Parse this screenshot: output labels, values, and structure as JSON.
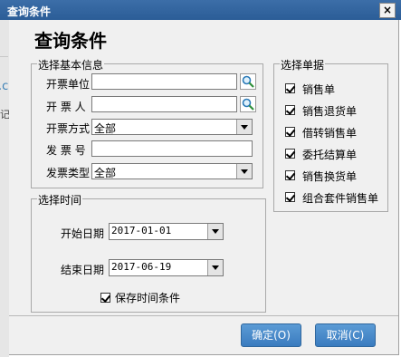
{
  "window": {
    "title": "查询条件",
    "close_glyph": "×"
  },
  "background_fragments": {
    "f2": ".c",
    "f3": "记"
  },
  "dialog": {
    "heading": "查询条件"
  },
  "basic_info": {
    "legend": "选择基本信息",
    "invoice_unit_label": "开票单位",
    "invoice_unit_value": "",
    "issuer_label": "开 票 人",
    "issuer_value": "",
    "invoice_method_label": "开票方式",
    "invoice_method_value": "全部",
    "invoice_no_label": "发 票 号",
    "invoice_no_value": "",
    "invoice_type_label": "发票类型",
    "invoice_type_value": "全部"
  },
  "time": {
    "legend": "选择时间",
    "start_label": "开始日期",
    "start_value": "2017-01-01",
    "end_label": "结束日期",
    "end_value": "2017-06-19",
    "save_label": "保存时间条件",
    "save_checked": true
  },
  "documents": {
    "legend": "选择单据",
    "items": [
      {
        "label": "销售单",
        "checked": true
      },
      {
        "label": "销售退货单",
        "checked": true
      },
      {
        "label": "借转销售单",
        "checked": true
      },
      {
        "label": "委托结算单",
        "checked": true
      },
      {
        "label": "销售换货单",
        "checked": true
      },
      {
        "label": "组合套件销售单",
        "checked": true
      }
    ]
  },
  "buttons": {
    "ok": "确定(O)",
    "cancel": "取消(C)"
  },
  "colors": {
    "title_bar": "#2b5d97",
    "button": "#4a8ccb",
    "dialog_bg": "#f0f0f0"
  }
}
